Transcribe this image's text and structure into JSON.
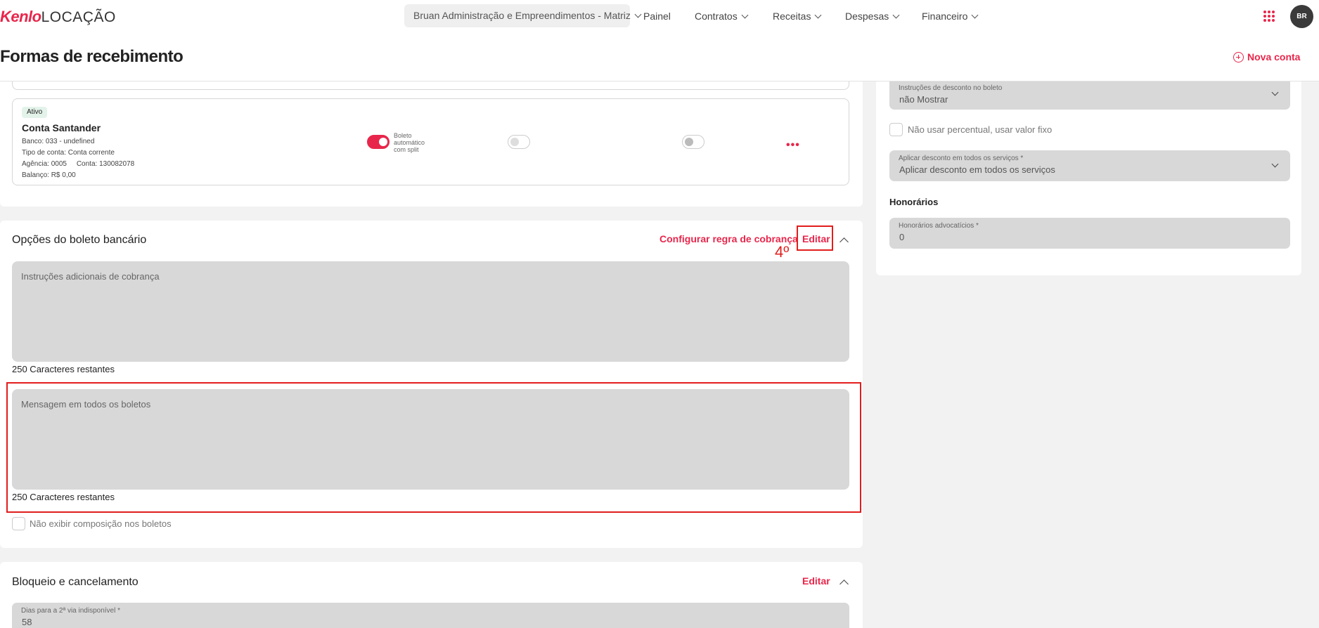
{
  "header": {
    "brand": "Kenlo",
    "product": "LOCAÇÃO",
    "company_selector": "Bruan Administração e Empreendimentos - Matriz",
    "nav": [
      "Painel",
      "Contratos",
      "Receitas",
      "Despesas",
      "Financeiro"
    ],
    "avatar_initials": "BR"
  },
  "page": {
    "title": "Formas de recebimento",
    "new_account_label": "Nova conta"
  },
  "bank_account": {
    "status": "Ativo",
    "name": "Conta Santander",
    "banco": "Banco: 033 - undefined",
    "tipo": "Tipo de conta: Conta corrente",
    "agencia_conta": "Agência: 0005     Conta: 130082078",
    "balanco": "Balanço: R$ 0,00",
    "toggle_label": "Boleto\nautomático\ncom split",
    "more_label": "•••"
  },
  "boleto_options": {
    "title": "Opções do boleto bancário",
    "configure_rule_label": "Configurar regra de cobrança",
    "edit_label": "Editar",
    "additional_instructions_label": "Instruções adicionais de cobrança",
    "additional_instructions_counter": "250 Caracteres restantes",
    "message_label": "Mensagem em todos os boletos",
    "message_counter": "250 Caracteres restantes",
    "hide_composition_label": "Não exibir composição nos boletos"
  },
  "blocking": {
    "title": "Bloqueio e cancelamento",
    "edit_label": "Editar",
    "days_label": "Dias para a 2ª via indisponível *",
    "days_value": "58"
  },
  "discount": {
    "instructions_label": "Instruções de desconto no boleto",
    "instructions_value": "não Mostrar",
    "fixed_value_label": "Não usar percentual, usar valor fixo",
    "apply_all_label": "Aplicar desconto em todos os serviços *",
    "apply_all_value": "Aplicar desconto em todos os serviços"
  },
  "fees": {
    "title": "Honorários",
    "lawyer_fees_label": "Honorários advocatícios *",
    "lawyer_fees_value": "0"
  },
  "annotation": {
    "step": "4º"
  }
}
